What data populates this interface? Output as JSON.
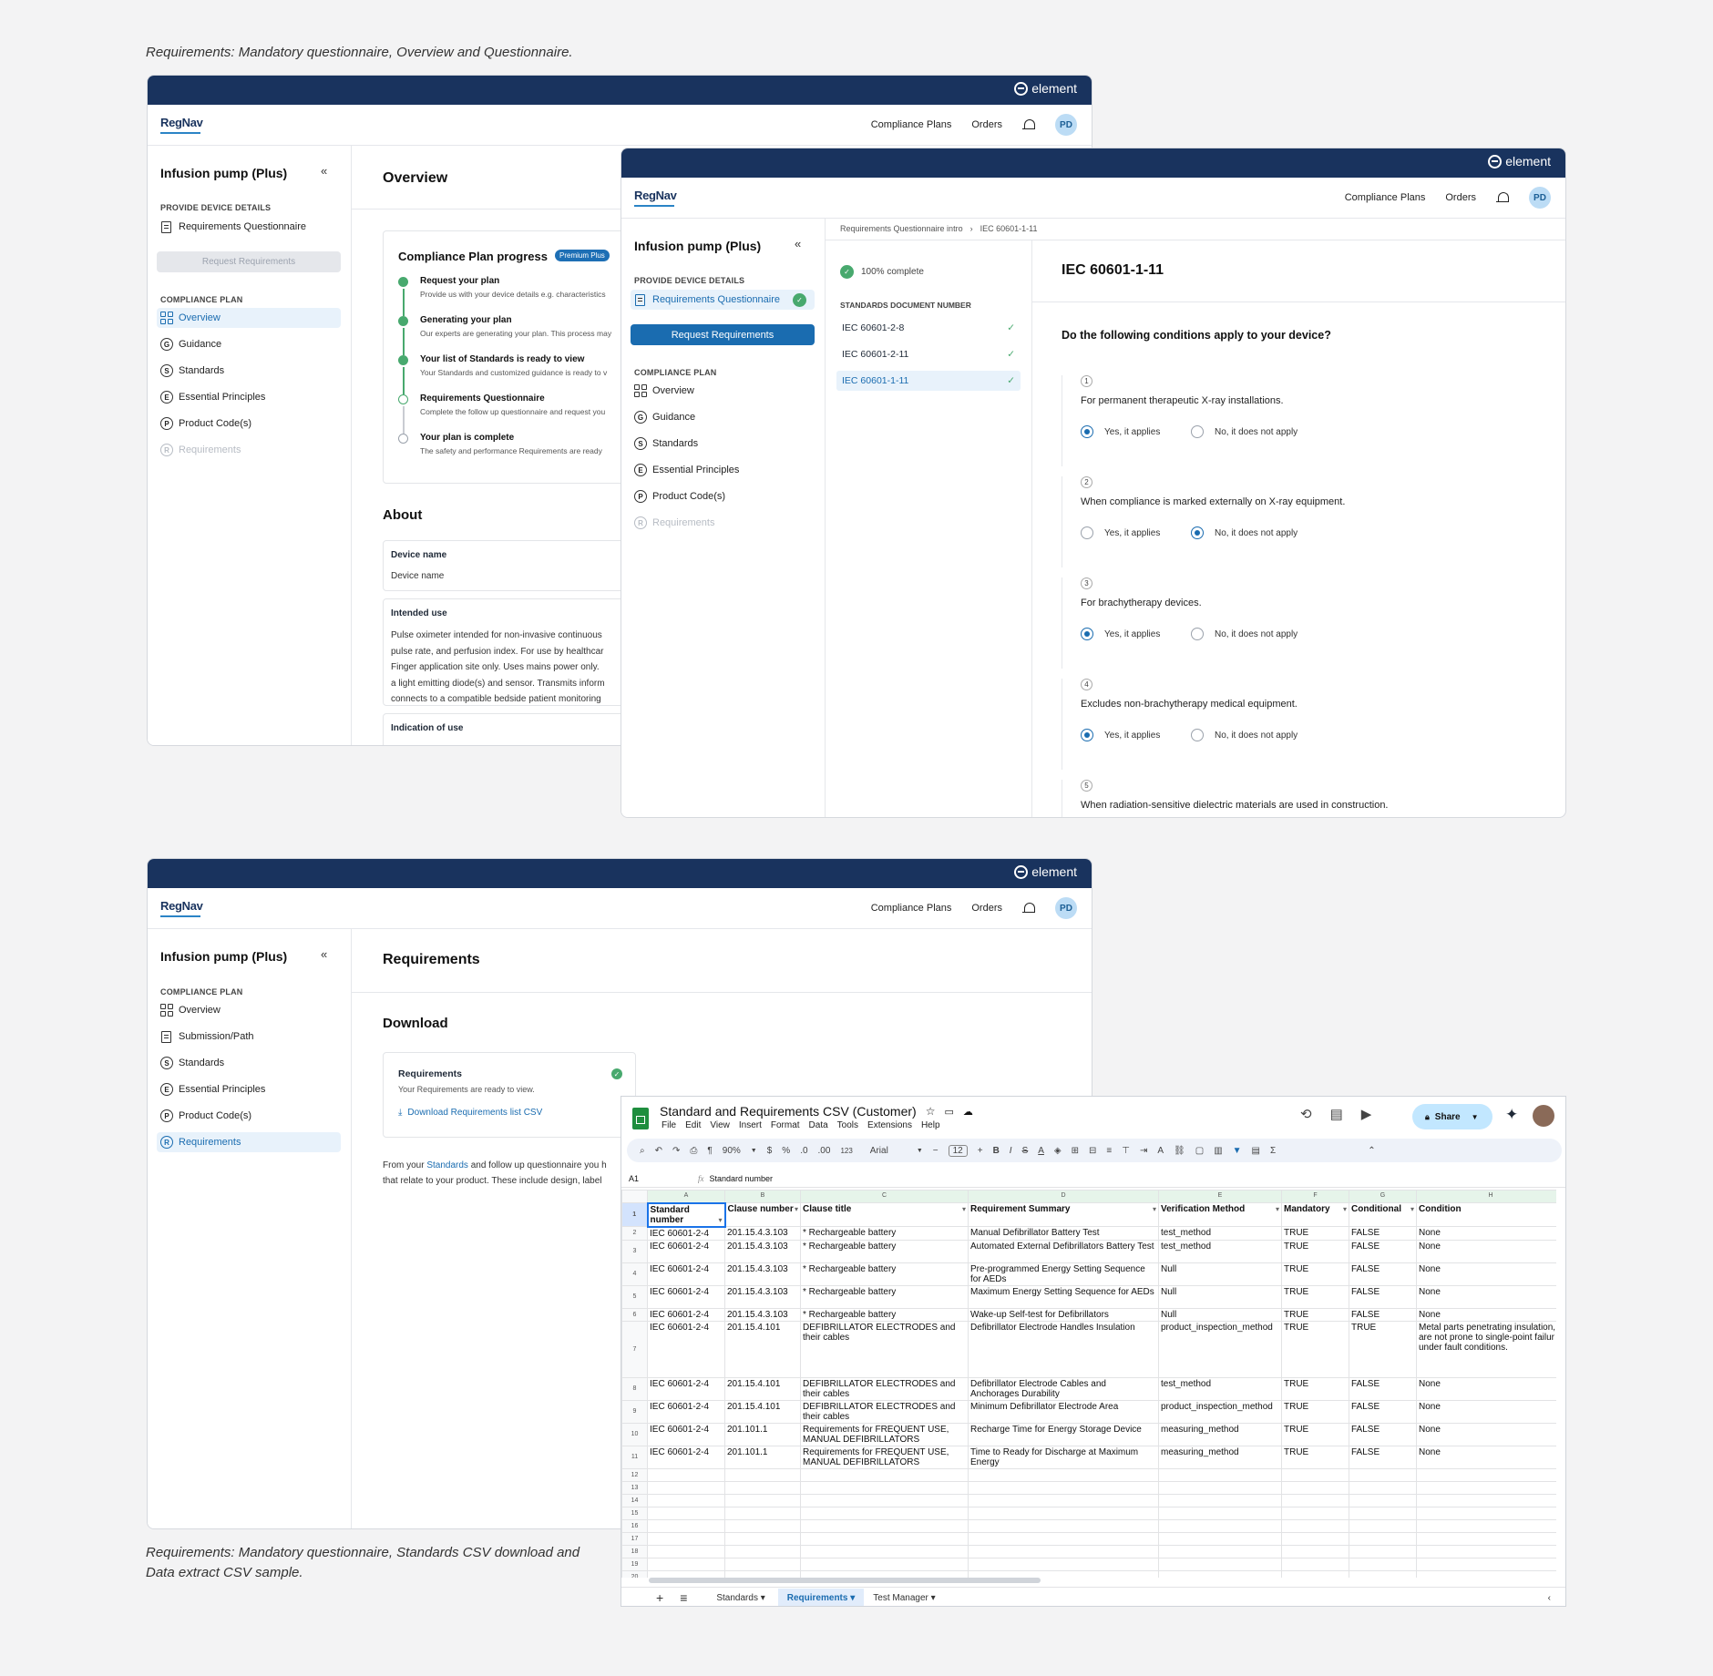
{
  "captions": {
    "top": "Requirements: Mandatory questionnaire, Overview and Questionnaire.",
    "bottom_line1": "Requirements: Mandatory questionnaire, Standards CSV download and",
    "bottom_line2": "Data extract CSV sample."
  },
  "brand": "element",
  "app_logo": "RegNav",
  "nav": {
    "compliance_plans": "Compliance Plans",
    "orders": "Orders",
    "avatar": "PD"
  },
  "project_title": "Infusion pump (Plus)",
  "collapse_icon": "«",
  "sidebar": {
    "provide_section": "PROVIDE DEVICE DETAILS",
    "req_questionnaire": "Requirements Questionnaire",
    "request_button": "Request Requirements",
    "plan_section": "COMPLIANCE PLAN",
    "overview": "Overview",
    "guidance": "Guidance",
    "standards": "Standards",
    "essential": "Essential Principles",
    "product_codes": "Product Code(s)",
    "requirements": "Requirements",
    "submission": "Submission/Path",
    "letters": {
      "g": "G",
      "s": "S",
      "e": "E",
      "p": "P",
      "r": "R"
    }
  },
  "overview": {
    "title": "Overview",
    "progress_title": "Compliance Plan progress",
    "badge": "Premium Plus",
    "steps": [
      {
        "title": "Request your plan",
        "desc": "Provide us with your device details e.g. characteristics"
      },
      {
        "title": "Generating your plan",
        "desc": "Our experts are generating your plan. This process may"
      },
      {
        "title": "Your list of Standards is ready to view",
        "desc": "Your Standards and customized guidance is ready to v"
      },
      {
        "title": "Requirements Questionnaire",
        "desc": "Complete the follow up questionnaire and request you"
      },
      {
        "title": "Your plan is complete",
        "desc": "The safety and performance Requirements are ready"
      }
    ],
    "about_title": "About",
    "device_name_label": "Device name",
    "device_name_value": "Device name",
    "intended_use_label": "Intended use",
    "intended_use_lines": [
      "Pulse oximeter intended for non-invasive continuous",
      "pulse rate, and perfusion index.  For use by healthcar",
      "Finger application site only.  Uses mains power only.",
      "a light emitting diode(s) and sensor. Transmits inform",
      "connects to a compatible bedside patient monitoring"
    ],
    "indication_label": "Indication of use"
  },
  "questionnaire": {
    "breadcrumb_1": "Requirements Questionnaire intro",
    "breadcrumb_sep": "›",
    "breadcrumb_2": "IEC 60601-1-11",
    "complete": "100% complete",
    "std_header": "STANDARDS DOCUMENT NUMBER",
    "standards": [
      "IEC 60601-2-8",
      "IEC 60601-2-11",
      "IEC 60601-1-11"
    ],
    "tick": "✓",
    "title": "IEC 60601-1-11",
    "question": "Do the following conditions apply to your device?",
    "yes": "Yes, it applies",
    "no": "No, it does not apply",
    "items": [
      {
        "n": "1",
        "text": "For permanent therapeutic X-ray installations.",
        "answer": "yes"
      },
      {
        "n": "2",
        "text": "When compliance is marked externally on X-ray equipment.",
        "answer": "no"
      },
      {
        "n": "3",
        "text": "For brachytherapy devices.",
        "answer": "yes"
      },
      {
        "n": "4",
        "text": "Excludes non-brachytherapy medical equipment.",
        "answer": "yes"
      },
      {
        "n": "5",
        "text": "When radiation-sensitive dielectric materials are used in construction.",
        "answer": ""
      }
    ]
  },
  "requirements_page": {
    "title": "Requirements",
    "download_title": "Download",
    "card_title": "Requirements",
    "card_desc": "Your Requirements are ready to view.",
    "download_link": "Download Requirements list CSV",
    "body_1a": "From your ",
    "body_1_link": "Standards",
    "body_1b": " and follow up questionnaire you h",
    "body_2": "that relate to your product. These include design, label"
  },
  "sheet": {
    "title": "Standard and Requirements CSV (Customer)",
    "menus": [
      "File",
      "Edit",
      "View",
      "Insert",
      "Format",
      "Data",
      "Tools",
      "Extensions",
      "Help"
    ],
    "share": "Share",
    "zoom": "90%",
    "font": "Arial",
    "font_size": "12",
    "cell_ref": "A1",
    "fx": "fx",
    "formula": "Standard number",
    "col_letters": [
      "A",
      "B",
      "C",
      "D",
      "E",
      "F",
      "G",
      "H"
    ],
    "headers": [
      "Standard number",
      "Clause number",
      "Clause title",
      "Requirement Summary",
      "Verification Method",
      "Mandatory",
      "Conditional",
      "Condition"
    ],
    "rows": [
      [
        "IEC 60601-2-4",
        "201.15.4.3.103",
        "* Rechargeable battery",
        "Manual Defibrillator Battery Test",
        "test_method",
        "TRUE",
        "FALSE",
        "None"
      ],
      [
        "IEC 60601-2-4",
        "201.15.4.3.103",
        "* Rechargeable battery",
        "Automated External Defibrillators Battery Test",
        "test_method",
        "TRUE",
        "FALSE",
        "None"
      ],
      [
        "IEC 60601-2-4",
        "201.15.4.3.103",
        "* Rechargeable battery",
        "Pre-programmed Energy Setting Sequence for AEDs",
        "Null",
        "TRUE",
        "FALSE",
        "None"
      ],
      [
        "IEC 60601-2-4",
        "201.15.4.3.103",
        "* Rechargeable battery",
        "Maximum Energy Setting Sequence for AEDs",
        "Null",
        "TRUE",
        "FALSE",
        "None"
      ],
      [
        "IEC 60601-2-4",
        "201.15.4.3.103",
        "* Rechargeable battery",
        "Wake-up Self-test for Defibrillators",
        "Null",
        "TRUE",
        "FALSE",
        "None"
      ],
      [
        "IEC 60601-2-4",
        "201.15.4.101",
        "DEFIBRILLATOR ELECTRODES and their cables",
        "Defibrillator Electrode Handles Insulation",
        "product_inspection_method",
        "TRUE",
        "TRUE",
        "Metal parts penetrating insulation, are not prone to single-point failur under fault conditions."
      ],
      [
        "IEC 60601-2-4",
        "201.15.4.101",
        "DEFIBRILLATOR ELECTRODES and their cables",
        "Defibrillator Electrode Cables and Anchorages Durability",
        "test_method",
        "TRUE",
        "FALSE",
        "None"
      ],
      [
        "IEC 60601-2-4",
        "201.15.4.101",
        "DEFIBRILLATOR ELECTRODES and their cables",
        "Minimum Defibrillator Electrode Area",
        "product_inspection_method",
        "TRUE",
        "FALSE",
        "None"
      ],
      [
        "IEC 60601-2-4",
        "201.101.1",
        "Requirements for FREQUENT USE, MANUAL DEFIBRILLATORS",
        "Recharge Time for Energy Storage Device",
        "measuring_method",
        "TRUE",
        "FALSE",
        "None"
      ],
      [
        "IEC 60601-2-4",
        "201.101.1",
        "Requirements for FREQUENT USE, MANUAL DEFIBRILLATORS",
        "Time to Ready for Discharge at Maximum Energy",
        "measuring_method",
        "TRUE",
        "FALSE",
        "None"
      ]
    ],
    "empty_rows": [
      "12",
      "13",
      "14",
      "15",
      "16",
      "17",
      "18",
      "19",
      "20"
    ],
    "tabs": [
      "Standards",
      "Requirements",
      "Test Manager"
    ],
    "add_sheet": "+",
    "all_sheets": "≡",
    "tab_arrow": "▾"
  }
}
